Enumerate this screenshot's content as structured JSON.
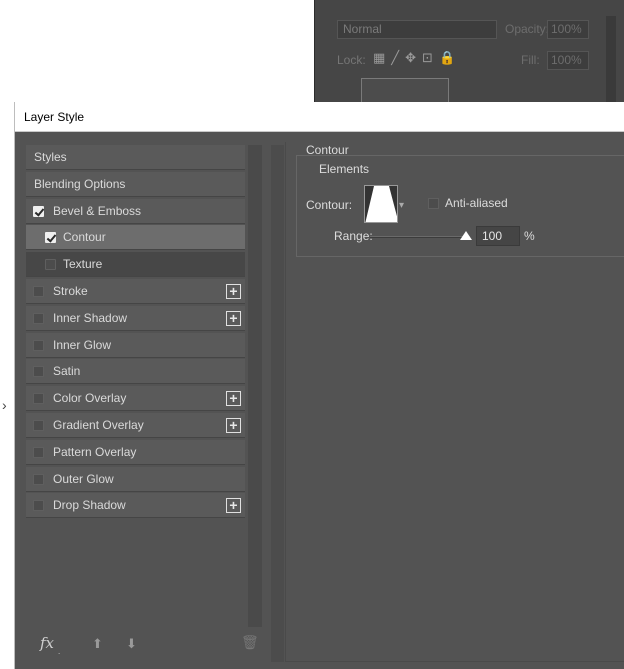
{
  "layers_panel": {
    "blend_mode": "Normal",
    "opacity_label": "Opacity:",
    "opacity_value": "100%",
    "lock_label": "Lock:",
    "lock_icons": [
      "transparency-lock-icon",
      "brush-icon",
      "move-icon",
      "artboard-icon",
      "lock-icon"
    ],
    "fill_label": "Fill:",
    "fill_value": "100%"
  },
  "dialog": {
    "title": "Layer Style",
    "left_list": [
      {
        "label": "Styles",
        "kind": "head"
      },
      {
        "label": "Blending Options",
        "kind": "head"
      },
      {
        "label": "Bevel & Emboss",
        "checked": true
      },
      {
        "label": "Contour",
        "checked": true,
        "sub": true,
        "selected": true
      },
      {
        "label": "Texture",
        "checked": false,
        "sub": true
      },
      {
        "label": "Stroke",
        "checked": false,
        "plus": true
      },
      {
        "label": "Inner Shadow",
        "checked": false,
        "plus": true
      },
      {
        "label": "Inner Glow",
        "checked": false
      },
      {
        "label": "Satin",
        "checked": false
      },
      {
        "label": "Color Overlay",
        "checked": false,
        "plus": true
      },
      {
        "label": "Gradient Overlay",
        "checked": false,
        "plus": true
      },
      {
        "label": "Pattern Overlay",
        "checked": false
      },
      {
        "label": "Outer Glow",
        "checked": false
      },
      {
        "label": "Drop Shadow",
        "checked": false,
        "plus": true
      }
    ],
    "bottom_icons": {
      "fx": "fx",
      "dot": "."
    },
    "contour_panel": {
      "section_title": "Contour",
      "group_title": "Elements",
      "contour_label": "Contour:",
      "anti_aliased_label": "Anti-aliased",
      "anti_aliased_checked": false,
      "range_label": "Range:",
      "range_value": "100",
      "range_unit": "%",
      "range_fraction": 1.0
    }
  },
  "colors": {
    "dialog_bg": "#535353",
    "selected_item": "#6d6d6d",
    "title_bar": "#ffffff"
  }
}
